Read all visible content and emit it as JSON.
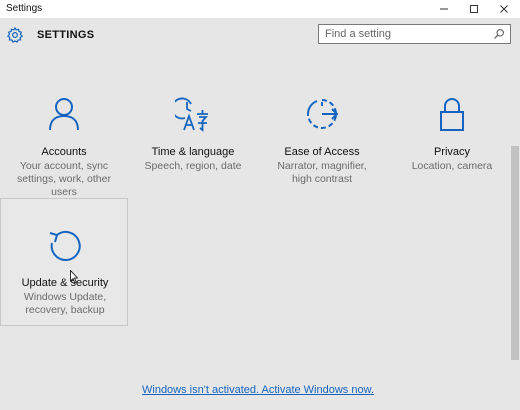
{
  "window": {
    "title": "Settings",
    "controls": [
      "minimize",
      "maximize",
      "close"
    ]
  },
  "header": {
    "icon": "gear-icon",
    "heading": "SETTINGS"
  },
  "search": {
    "placeholder": "Find a setting",
    "value": "",
    "icon": "search-icon"
  },
  "tiles": [
    {
      "name": "Accounts",
      "desc": "Your account, sync settings, work, other users",
      "icon": "person-icon"
    },
    {
      "name": "Time & language",
      "desc": "Speech, region, date",
      "icon": "time-language-icon"
    },
    {
      "name": "Ease of Access",
      "desc": "Narrator, magnifier, high contrast",
      "icon": "ease-of-access-icon"
    },
    {
      "name": "Privacy",
      "desc": "Location, camera",
      "icon": "lock-icon"
    },
    {
      "name": "Update & security",
      "desc": "Windows Update, recovery, backup",
      "icon": "refresh-icon"
    }
  ],
  "footer": {
    "activation_link": "Windows isn't activated. Activate Windows now."
  },
  "colors": {
    "accent": "#1565c0",
    "background": "#e6e6e6",
    "description": "#6b6b6b"
  }
}
